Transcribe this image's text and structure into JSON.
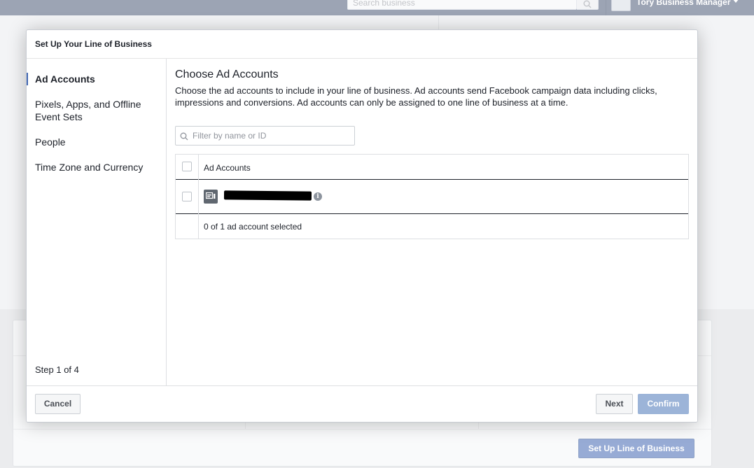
{
  "background": {
    "search_placeholder": "Search business",
    "business_name": "Tory Business Manager",
    "setup_button": "Set Up Line of Business"
  },
  "dialog": {
    "title": "Set Up Your Line of Business",
    "sidebar": {
      "items": [
        {
          "label": "Ad Accounts",
          "active": true
        },
        {
          "label": "Pixels, Apps, and Offline Event Sets",
          "active": false
        },
        {
          "label": "People",
          "active": false
        },
        {
          "label": "Time Zone and Currency",
          "active": false
        }
      ],
      "step": "Step 1 of 4"
    },
    "main": {
      "title": "Choose Ad Accounts",
      "description": "Choose the ad accounts to include in your line of business. Ad accounts send Facebook campaign data including clicks, impressions and conversions. Ad accounts can only be assigned to one line of business at a time.",
      "filter_placeholder": "Filter by name or ID",
      "table": {
        "header": "Ad Accounts",
        "rows": [
          {
            "name": "",
            "redacted": true,
            "checked": false
          }
        ],
        "footer": "0 of 1 ad account selected"
      }
    },
    "footer": {
      "cancel": "Cancel",
      "next": "Next",
      "confirm": "Confirm"
    }
  },
  "colors": {
    "topbar": "#4b5977",
    "accent": "#4267b2",
    "confirm_disabled": "#9cb4d8"
  }
}
